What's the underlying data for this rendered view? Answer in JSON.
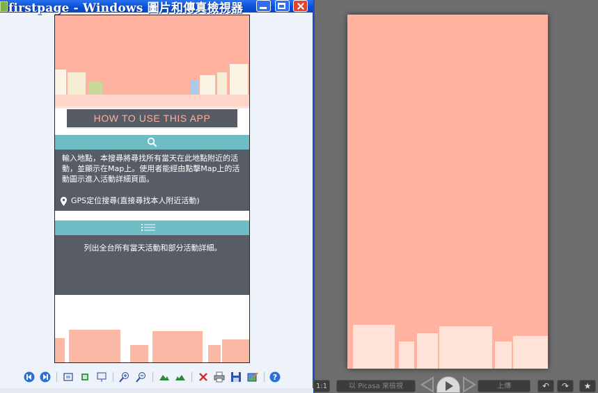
{
  "viewer": {
    "title": "firstpage - Windows 圖片和傳真檢視器",
    "phone": {
      "heading": "HOW TO USE THIS APP",
      "search_description": "輸入地點，本搜尋將尋找所有當天在此地點附近的活動，並顯示在Map上。使用者能經由點擊Map上的活動圖示進入活動詳細頁面。",
      "gps_label": "GPS定位搜尋(直接尋找本人附近活動)",
      "list_description": "列出全台所有當天活動和部分活動詳細。"
    },
    "toolbar_icons": [
      "previous-image-icon",
      "next-image-icon",
      "best-fit-icon",
      "actual-size-icon",
      "slideshow-icon",
      "zoom-in-icon",
      "zoom-out-icon",
      "rotate-clockwise-icon",
      "rotate-counterclockwise-icon",
      "delete-icon",
      "print-icon",
      "save-icon",
      "open-editor-icon",
      "help-icon"
    ]
  },
  "picasa": {
    "left_label": "1:1",
    "picasa_label": "以 Picasa 來檢視",
    "upload_label": "上傳",
    "star_icon": "★",
    "rotate_left_icon": "↶",
    "rotate_right_icon": "↷"
  },
  "colors": {
    "salmon": "#ffb2a0",
    "dark_panel": "#575c66",
    "teal": "#6ebdc4",
    "title_blue": "#0a4fd8"
  }
}
